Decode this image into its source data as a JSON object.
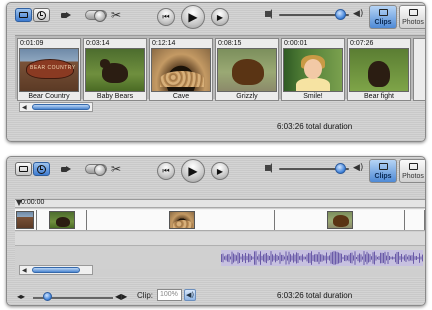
{
  "top_window": {
    "toolbar": {
      "mode_clip_icon": "clip-view-icon",
      "mode_timeline_icon": "timeline-view-icon",
      "camera_icon": "camera-icon",
      "scissors_glyph": "✂",
      "rewind_glyph": "⏮",
      "play_glyph": "▶",
      "fullscreen_glyph": "▶",
      "tabs": [
        {
          "label": "Clips"
        },
        {
          "label": "Photos"
        }
      ]
    },
    "clips": [
      {
        "time": "0:01:09",
        "name": "Bear Country",
        "sign_text": "BEAR COUNTRY"
      },
      {
        "time": "0:03:14",
        "name": "Baby Bears"
      },
      {
        "time": "0:12:14",
        "name": "Cave"
      },
      {
        "time": "0:08:15",
        "name": "Grizzly"
      },
      {
        "time": "0:00:01",
        "name": "Smile!"
      },
      {
        "time": "0:07:26",
        "name": "Bear fight"
      }
    ],
    "scroll_arrow": "◀",
    "total_duration": "6:03:26 total duration"
  },
  "bottom_window": {
    "toolbar": {
      "scissors_glyph": "✂",
      "rewind_glyph": "⏮",
      "play_glyph": "▶",
      "fullscreen_glyph": "▶",
      "tabs": [
        {
          "label": "Clips"
        },
        {
          "label": "Photos"
        }
      ]
    },
    "timeline": {
      "playhead_time": "0:00:00"
    },
    "scroll_arrow": "◀",
    "zoom_small_glyph": "◂▸",
    "zoom_large_glyph": "◀▶",
    "clip_volume_label": "Clip:",
    "clip_volume_value": "100%",
    "speaker_glyph": "◀)",
    "total_duration": "6:03:26 total duration"
  },
  "colors": {
    "accent_blue": "#3d7bd0",
    "waveform_purple": "#6a5aa8"
  }
}
